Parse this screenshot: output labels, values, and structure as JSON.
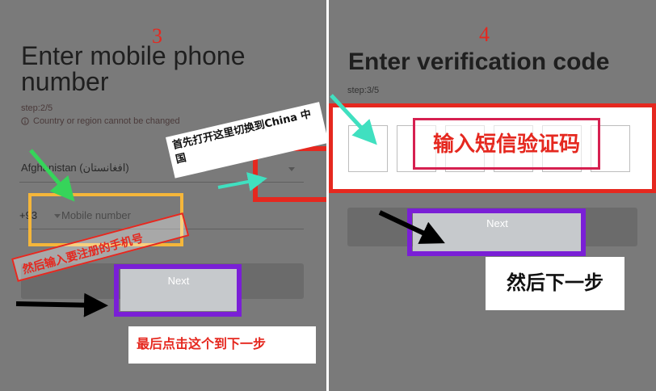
{
  "left": {
    "step_number": "3",
    "title_line1": "Enter mobile phone",
    "title_line2": "number",
    "step": "step:2/5",
    "warning_icon": "info-circle-icon",
    "warning": "Country or region cannot be changed",
    "country": "Afghanistan (افغانستان)",
    "code_prefix": "+93",
    "phone_placeholder": "Mobile number",
    "next_label": "Next",
    "note_switch": "首先打开这里切换到China 中国",
    "note_enter_phone": "然后输入要注册的手机号",
    "note_click_next": "最后点击这个到下一步"
  },
  "right": {
    "step_number": "4",
    "title": "Enter verification code",
    "step": "step:3/5",
    "note_sms_code": "输入短信验证码",
    "next_label": "Next",
    "note_next_step": "然后下一步"
  },
  "colors": {
    "background": "#7a7a7a",
    "annotation_red": "#e5281f",
    "annotation_orange": "#f5b63a",
    "annotation_purple": "#7a1fd6",
    "arrow_green": "#3ddc84",
    "arrow_teal": "#40e0c0",
    "arrow_black": "#000000"
  }
}
